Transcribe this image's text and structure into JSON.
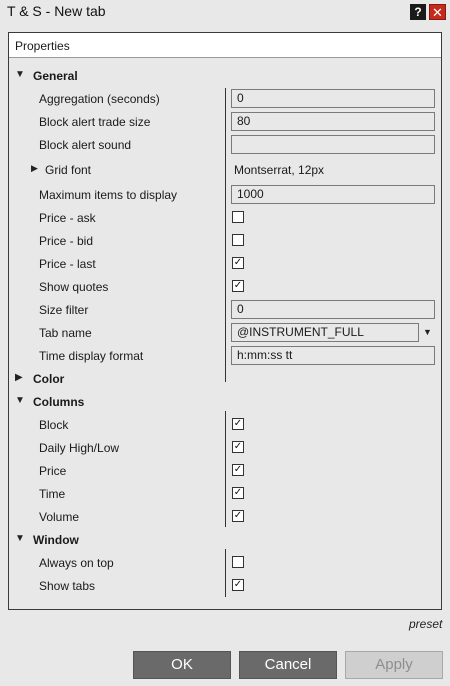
{
  "window": {
    "title": "T & S - New tab",
    "help_label": "?",
    "close_label": "✕"
  },
  "panel": {
    "header": "Properties"
  },
  "general": {
    "label": "General",
    "aggregation": {
      "label": "Aggregation (seconds)",
      "value": "0"
    },
    "block_alert_trade_size": {
      "label": "Block alert trade size",
      "value": "80"
    },
    "block_alert_sound": {
      "label": "Block alert sound",
      "value": ""
    },
    "grid_font": {
      "label": "Grid font",
      "value": "Montserrat, 12px"
    },
    "max_items": {
      "label": "Maximum items to display",
      "value": "1000"
    },
    "price_ask": {
      "label": "Price - ask",
      "checked": false
    },
    "price_bid": {
      "label": "Price - bid",
      "checked": false
    },
    "price_last": {
      "label": "Price - last",
      "checked": true
    },
    "show_quotes": {
      "label": "Show quotes",
      "checked": true
    },
    "size_filter": {
      "label": "Size filter",
      "value": "0"
    },
    "tab_name": {
      "label": "Tab name",
      "value": "@INSTRUMENT_FULL"
    },
    "time_display_format": {
      "label": "Time display format",
      "value": "h:mm:ss tt"
    }
  },
  "color": {
    "label": "Color"
  },
  "columns": {
    "label": "Columns",
    "block": {
      "label": "Block",
      "checked": true
    },
    "daily_high_low": {
      "label": "Daily High/Low",
      "checked": true
    },
    "price": {
      "label": "Price",
      "checked": true
    },
    "time": {
      "label": "Time",
      "checked": true
    },
    "volume": {
      "label": "Volume",
      "checked": true
    }
  },
  "window_section": {
    "label": "Window",
    "always_on_top": {
      "label": "Always on top",
      "checked": false
    },
    "show_tabs": {
      "label": "Show tabs",
      "checked": true
    }
  },
  "footer": {
    "preset": "preset",
    "ok": "OK",
    "cancel": "Cancel",
    "apply": "Apply"
  },
  "glyphs": {
    "expanded": "▼",
    "collapsed": "▶",
    "sub_collapsed": "▶",
    "combo": "▼",
    "check": "✓"
  }
}
